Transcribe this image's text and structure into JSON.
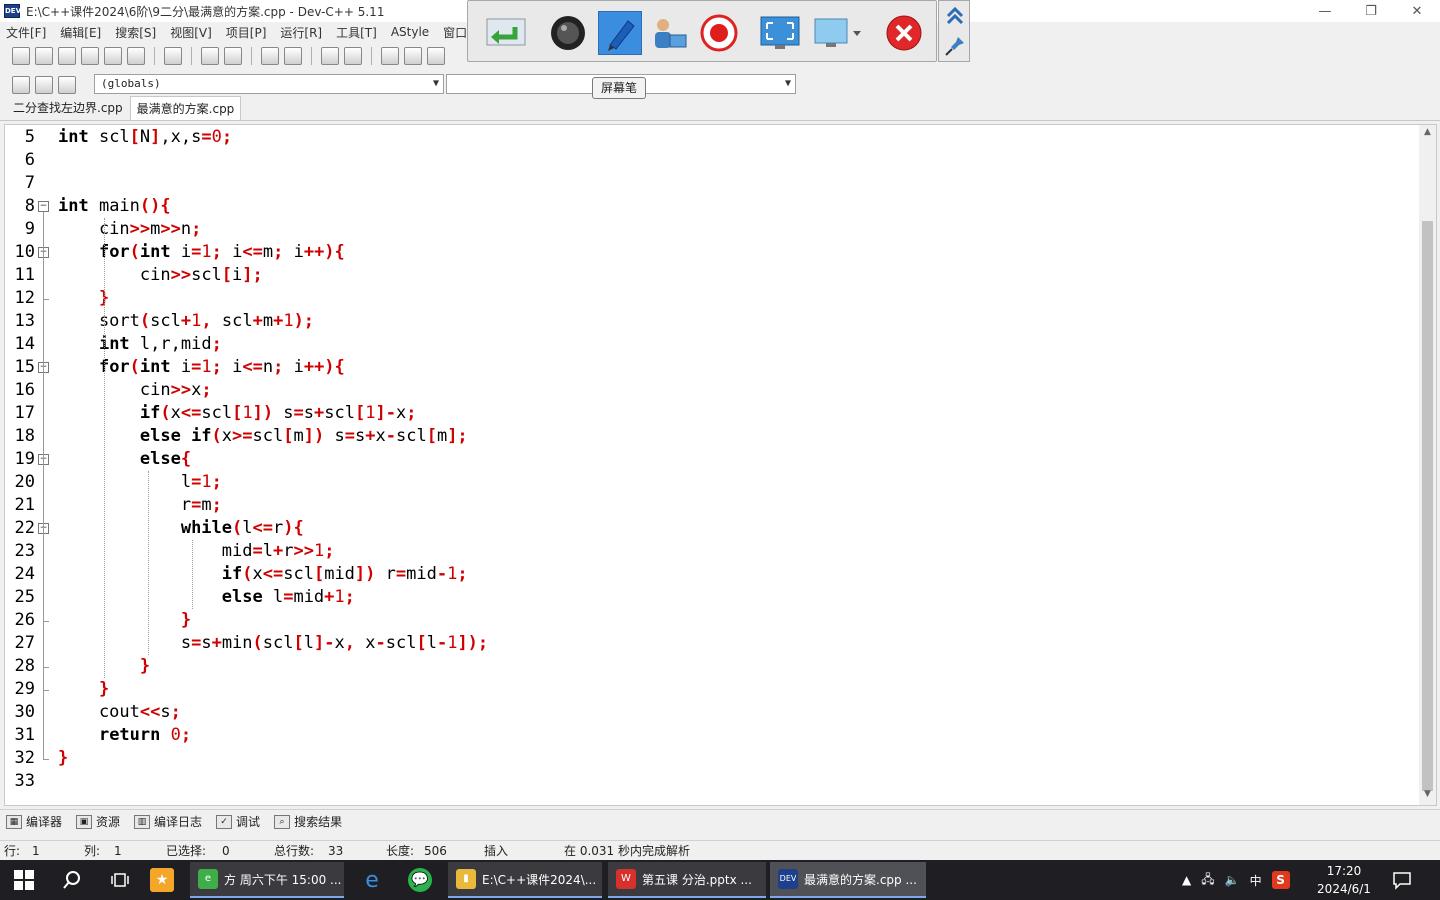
{
  "window": {
    "title": "E:\\C++课件2024\\6阶\\9二分\\最满意的方案.cpp - Dev-C++ 5.11",
    "app_icon_text": "DEV",
    "minimize": "—",
    "restore": "❐",
    "close": "✕"
  },
  "menu": [
    "文件[F]",
    "编辑[E]",
    "搜索[S]",
    "视图[V]",
    "项目[P]",
    "运行[R]",
    "工具[T]",
    "AStyle",
    "窗口[W"
  ],
  "toolbar": {
    "globals_combo": "(globals)",
    "second_combo": ""
  },
  "tabs": [
    {
      "label": "二分查找左边界.cpp",
      "active": false
    },
    {
      "label": "最满意的方案.cpp",
      "active": true
    }
  ],
  "code_lines": [
    {
      "n": "5",
      "fold": "",
      "parts": [
        [
          "kw",
          "int"
        ],
        [
          "t",
          " scl"
        ],
        [
          "s",
          "["
        ],
        [
          "t",
          "N"
        ],
        [
          "s",
          "]"
        ],
        [
          "t",
          ",x,s"
        ],
        [
          "s",
          "="
        ],
        [
          "n",
          "0"
        ],
        [
          "s",
          ";"
        ]
      ]
    },
    {
      "n": "6",
      "fold": "",
      "parts": []
    },
    {
      "n": "7",
      "fold": "",
      "parts": []
    },
    {
      "n": "8",
      "fold": "open",
      "parts": [
        [
          "kw",
          "int"
        ],
        [
          "t",
          " main"
        ],
        [
          "s",
          "(){"
        ]
      ]
    },
    {
      "n": "9",
      "fold": "",
      "parts": [
        [
          "t",
          "    cin"
        ],
        [
          "s",
          ">>"
        ],
        [
          "t",
          "m"
        ],
        [
          "s",
          ">>"
        ],
        [
          "t",
          "n"
        ],
        [
          "s",
          ";"
        ]
      ]
    },
    {
      "n": "10",
      "fold": "open",
      "parts": [
        [
          "t",
          "    "
        ],
        [
          "kw",
          "for"
        ],
        [
          "s",
          "("
        ],
        [
          "kw",
          "int"
        ],
        [
          "t",
          " i"
        ],
        [
          "s",
          "="
        ],
        [
          "n",
          "1"
        ],
        [
          "s",
          ";"
        ],
        [
          "t",
          " i"
        ],
        [
          "s",
          "<="
        ],
        [
          "t",
          "m"
        ],
        [
          "s",
          ";"
        ],
        [
          "t",
          " i"
        ],
        [
          "s",
          "++){"
        ]
      ]
    },
    {
      "n": "11",
      "fold": "",
      "parts": [
        [
          "t",
          "        cin"
        ],
        [
          "s",
          ">>"
        ],
        [
          "t",
          "scl"
        ],
        [
          "s",
          "["
        ],
        [
          "t",
          "i"
        ],
        [
          "s",
          "];"
        ]
      ]
    },
    {
      "n": "12",
      "fold": "end",
      "parts": [
        [
          "t",
          "    "
        ],
        [
          "s",
          "}"
        ]
      ]
    },
    {
      "n": "13",
      "fold": "",
      "parts": [
        [
          "t",
          "    sort"
        ],
        [
          "s",
          "("
        ],
        [
          "t",
          "scl"
        ],
        [
          "s",
          "+"
        ],
        [
          "n",
          "1"
        ],
        [
          "s",
          ","
        ],
        [
          "t",
          " scl"
        ],
        [
          "s",
          "+"
        ],
        [
          "t",
          "m"
        ],
        [
          "s",
          "+"
        ],
        [
          "n",
          "1"
        ],
        [
          "s",
          ");"
        ]
      ]
    },
    {
      "n": "14",
      "fold": "",
      "parts": [
        [
          "t",
          "    "
        ],
        [
          "kw",
          "int"
        ],
        [
          "t",
          " l,r,mid"
        ],
        [
          "s",
          ";"
        ]
      ]
    },
    {
      "n": "15",
      "fold": "open",
      "parts": [
        [
          "t",
          "    "
        ],
        [
          "kw",
          "for"
        ],
        [
          "s",
          "("
        ],
        [
          "kw",
          "int"
        ],
        [
          "t",
          " i"
        ],
        [
          "s",
          "="
        ],
        [
          "n",
          "1"
        ],
        [
          "s",
          ";"
        ],
        [
          "t",
          " i"
        ],
        [
          "s",
          "<="
        ],
        [
          "t",
          "n"
        ],
        [
          "s",
          ";"
        ],
        [
          "t",
          " i"
        ],
        [
          "s",
          "++){"
        ]
      ]
    },
    {
      "n": "16",
      "fold": "",
      "parts": [
        [
          "t",
          "        cin"
        ],
        [
          "s",
          ">>"
        ],
        [
          "t",
          "x"
        ],
        [
          "s",
          ";"
        ]
      ]
    },
    {
      "n": "17",
      "fold": "",
      "parts": [
        [
          "t",
          "        "
        ],
        [
          "kw",
          "if"
        ],
        [
          "s",
          "("
        ],
        [
          "t",
          "x"
        ],
        [
          "s",
          "<="
        ],
        [
          "t",
          "scl"
        ],
        [
          "s",
          "["
        ],
        [
          "n",
          "1"
        ],
        [
          "s",
          "])"
        ],
        [
          "t",
          " s"
        ],
        [
          "s",
          "="
        ],
        [
          "t",
          "s"
        ],
        [
          "s",
          "+"
        ],
        [
          "t",
          "scl"
        ],
        [
          "s",
          "["
        ],
        [
          "n",
          "1"
        ],
        [
          "s",
          "]-"
        ],
        [
          "t",
          "x"
        ],
        [
          "s",
          ";"
        ]
      ]
    },
    {
      "n": "18",
      "fold": "",
      "parts": [
        [
          "t",
          "        "
        ],
        [
          "kw",
          "else if"
        ],
        [
          "s",
          "("
        ],
        [
          "t",
          "x"
        ],
        [
          "s",
          ">="
        ],
        [
          "t",
          "scl"
        ],
        [
          "s",
          "["
        ],
        [
          "t",
          "m"
        ],
        [
          "s",
          "])"
        ],
        [
          "t",
          " s"
        ],
        [
          "s",
          "="
        ],
        [
          "t",
          "s"
        ],
        [
          "s",
          "+"
        ],
        [
          "t",
          "x"
        ],
        [
          "s",
          "-"
        ],
        [
          "t",
          "scl"
        ],
        [
          "s",
          "["
        ],
        [
          "t",
          "m"
        ],
        [
          "s",
          "];"
        ]
      ]
    },
    {
      "n": "19",
      "fold": "open",
      "parts": [
        [
          "t",
          "        "
        ],
        [
          "kw",
          "else"
        ],
        [
          "s",
          "{"
        ]
      ]
    },
    {
      "n": "20",
      "fold": "",
      "parts": [
        [
          "t",
          "            l"
        ],
        [
          "s",
          "="
        ],
        [
          "n",
          "1"
        ],
        [
          "s",
          ";"
        ]
      ]
    },
    {
      "n": "21",
      "fold": "",
      "parts": [
        [
          "t",
          "            r"
        ],
        [
          "s",
          "="
        ],
        [
          "t",
          "m"
        ],
        [
          "s",
          ";"
        ]
      ]
    },
    {
      "n": "22",
      "fold": "open",
      "parts": [
        [
          "t",
          "            "
        ],
        [
          "kw",
          "while"
        ],
        [
          "s",
          "("
        ],
        [
          "t",
          "l"
        ],
        [
          "s",
          "<="
        ],
        [
          "t",
          "r"
        ],
        [
          "s",
          "){"
        ]
      ]
    },
    {
      "n": "23",
      "fold": "",
      "parts": [
        [
          "t",
          "                mid"
        ],
        [
          "s",
          "="
        ],
        [
          "t",
          "l"
        ],
        [
          "s",
          "+"
        ],
        [
          "t",
          "r"
        ],
        [
          "s",
          ">>"
        ],
        [
          "n",
          "1"
        ],
        [
          "s",
          ";"
        ]
      ]
    },
    {
      "n": "24",
      "fold": "",
      "parts": [
        [
          "t",
          "                "
        ],
        [
          "kw",
          "if"
        ],
        [
          "s",
          "("
        ],
        [
          "t",
          "x"
        ],
        [
          "s",
          "<="
        ],
        [
          "t",
          "scl"
        ],
        [
          "s",
          "["
        ],
        [
          "t",
          "mid"
        ],
        [
          "s",
          "])"
        ],
        [
          "t",
          " r"
        ],
        [
          "s",
          "="
        ],
        [
          "t",
          "mid"
        ],
        [
          "s",
          "-"
        ],
        [
          "n",
          "1"
        ],
        [
          "s",
          ";"
        ]
      ]
    },
    {
      "n": "25",
      "fold": "",
      "parts": [
        [
          "t",
          "                "
        ],
        [
          "kw",
          "else"
        ],
        [
          "t",
          " l"
        ],
        [
          "s",
          "="
        ],
        [
          "t",
          "mid"
        ],
        [
          "s",
          "+"
        ],
        [
          "n",
          "1"
        ],
        [
          "s",
          ";"
        ]
      ]
    },
    {
      "n": "26",
      "fold": "end",
      "parts": [
        [
          "t",
          "            "
        ],
        [
          "s",
          "}"
        ]
      ]
    },
    {
      "n": "27",
      "fold": "",
      "parts": [
        [
          "t",
          "            s"
        ],
        [
          "s",
          "="
        ],
        [
          "t",
          "s"
        ],
        [
          "s",
          "+"
        ],
        [
          "t",
          "min"
        ],
        [
          "s",
          "("
        ],
        [
          "t",
          "scl"
        ],
        [
          "s",
          "["
        ],
        [
          "t",
          "l"
        ],
        [
          "s",
          "]-"
        ],
        [
          "t",
          "x"
        ],
        [
          "s",
          ","
        ],
        [
          "t",
          " x"
        ],
        [
          "s",
          "-"
        ],
        [
          "t",
          "scl"
        ],
        [
          "s",
          "["
        ],
        [
          "t",
          "l"
        ],
        [
          "s",
          "-"
        ],
        [
          "n",
          "1"
        ],
        [
          "s",
          "]);"
        ]
      ]
    },
    {
      "n": "28",
      "fold": "end",
      "parts": [
        [
          "t",
          "        "
        ],
        [
          "s",
          "}"
        ]
      ]
    },
    {
      "n": "29",
      "fold": "end",
      "parts": [
        [
          "t",
          "    "
        ],
        [
          "s",
          "}"
        ]
      ]
    },
    {
      "n": "30",
      "fold": "",
      "parts": [
        [
          "t",
          "    cout"
        ],
        [
          "s",
          "<<"
        ],
        [
          "t",
          "s"
        ],
        [
          "s",
          ";"
        ]
      ]
    },
    {
      "n": "31",
      "fold": "",
      "parts": [
        [
          "t",
          "    "
        ],
        [
          "kw",
          "return"
        ],
        [
          "t",
          " "
        ],
        [
          "n",
          "0"
        ],
        [
          "s",
          ";"
        ]
      ]
    },
    {
      "n": "32",
      "fold": "end",
      "parts": [
        [
          "s",
          "}"
        ]
      ]
    },
    {
      "n": "33",
      "fold": "",
      "parts": []
    }
  ],
  "bottom_tabs": [
    "编译器",
    "资源",
    "编译日志",
    "调试",
    "搜索结果"
  ],
  "status": {
    "row_label": "行:",
    "row": "1",
    "col_label": "列:",
    "col": "1",
    "sel_label": "已选择:",
    "sel": "0",
    "total_label": "总行数:",
    "total": "33",
    "len_label": "长度:",
    "len": "506",
    "mode": "插入",
    "parse": "在 0.031 秒内完成解析"
  },
  "overlay": {
    "tooltip": "屏幕笔"
  },
  "taskbar": {
    "apps": [
      {
        "label": "方 周六下午 15:00 ...",
        "color": "#3fae49"
      },
      {
        "label": "E:\\C++课件2024\\...",
        "color": "#e8b93a"
      },
      {
        "label": "第五课  分治.pptx ...",
        "color": "#d6322b"
      },
      {
        "label": "最满意的方案.cpp ...",
        "color": "#1e3f8c"
      }
    ],
    "ime": "中",
    "time": "17:20",
    "date": "2024/6/1"
  }
}
